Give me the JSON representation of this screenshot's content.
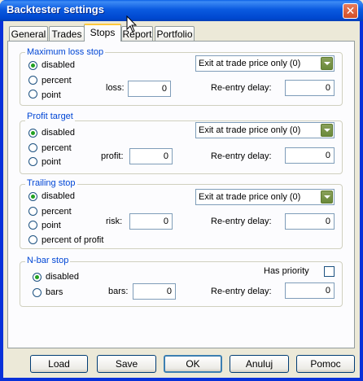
{
  "window": {
    "title": "Backtester settings",
    "close_glyph": "✕"
  },
  "tabs": [
    {
      "label": "General",
      "active": false
    },
    {
      "label": "Trades",
      "active": false
    },
    {
      "label": "Stops",
      "active": true
    },
    {
      "label": "Report",
      "active": false
    },
    {
      "label": "Portfolio",
      "active": false
    }
  ],
  "groups": {
    "max_loss": {
      "legend": "Maximum loss stop",
      "radios": [
        {
          "label": "disabled",
          "checked": true
        },
        {
          "label": "percent",
          "checked": false
        },
        {
          "label": "point",
          "checked": false
        }
      ],
      "amount_label": "loss:",
      "amount_value": "0",
      "exit_mode": "Exit at trade price only (0)",
      "reentry_label": "Re-entry delay:",
      "reentry_value": "0"
    },
    "profit_target": {
      "legend": "Profit target",
      "radios": [
        {
          "label": "disabled",
          "checked": true
        },
        {
          "label": "percent",
          "checked": false
        },
        {
          "label": "point",
          "checked": false
        }
      ],
      "amount_label": "profit:",
      "amount_value": "0",
      "exit_mode": "Exit at trade price only (0)",
      "reentry_label": "Re-entry delay:",
      "reentry_value": "0"
    },
    "trailing": {
      "legend": "Trailing stop",
      "radios": [
        {
          "label": "disabled",
          "checked": true
        },
        {
          "label": "percent",
          "checked": false
        },
        {
          "label": "point",
          "checked": false
        },
        {
          "label": "percent of profit",
          "checked": false
        }
      ],
      "amount_label": "risk:",
      "amount_value": "0",
      "exit_mode": "Exit at trade price only (0)",
      "reentry_label": "Re-entry delay:",
      "reentry_value": "0"
    },
    "nbar": {
      "legend": "N-bar stop",
      "radios": [
        {
          "label": "disabled",
          "checked": true
        },
        {
          "label": "bars",
          "checked": false
        }
      ],
      "priority_label": "Has priority",
      "amount_label": "bars:",
      "amount_value": "0",
      "reentry_label": "Re-entry delay:",
      "reentry_value": "0"
    }
  },
  "buttons": {
    "load": "Load",
    "save": "Save",
    "ok": "OK",
    "cancel": "Anuluj",
    "help": "Pomoc"
  },
  "colors": {
    "titlebar": "#0a5ae0",
    "legend": "#0046d5",
    "radio_dot": "#21a121"
  }
}
